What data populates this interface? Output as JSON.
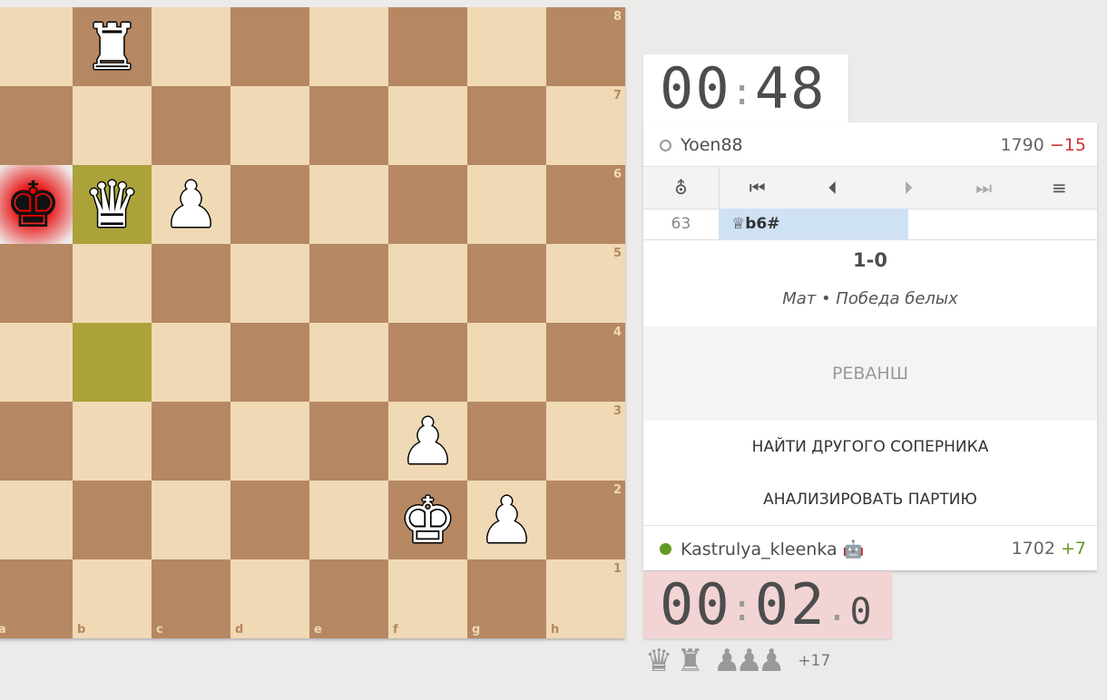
{
  "board": {
    "ranks": [
      "8",
      "7",
      "6",
      "5",
      "4",
      "3",
      "2",
      "1"
    ],
    "files": [
      "a",
      "b",
      "c",
      "d",
      "e",
      "f",
      "g",
      "h"
    ],
    "pieces": [
      {
        "square": "b8",
        "piece": "♜",
        "color": "white",
        "name": "white-rook"
      },
      {
        "square": "a6",
        "piece": "♚",
        "color": "black",
        "name": "black-king"
      },
      {
        "square": "b6",
        "piece": "♛",
        "color": "white",
        "name": "white-queen"
      },
      {
        "square": "c6",
        "piece": "♟",
        "color": "white",
        "name": "white-pawn"
      },
      {
        "square": "f3",
        "piece": "♟",
        "color": "white",
        "name": "white-pawn"
      },
      {
        "square": "f2",
        "piece": "♚",
        "color": "white",
        "name": "white-king"
      },
      {
        "square": "g2",
        "piece": "♟",
        "color": "white",
        "name": "white-pawn"
      }
    ],
    "highlighted": [
      "b6",
      "b4"
    ],
    "check": "a6"
  },
  "top_clock": {
    "minutes": "00",
    "seconds": "48",
    "remaining_fraction": 0.35
  },
  "top_player": {
    "name": "Yoen88",
    "rating": "1790",
    "diff": "−15",
    "online": false
  },
  "controls": {
    "analysis": "⛢",
    "first": "⏮",
    "prev": "⏴",
    "next": "⏵",
    "last": "⏭",
    "menu": "≡"
  },
  "moves": {
    "index": "63",
    "move": "♕b6#"
  },
  "result": {
    "score": "1-0",
    "status": "Мат • Победа белых"
  },
  "actions": {
    "rematch": "РЕВАНШ",
    "new_opponent": "НАЙТИ ДРУГОГО СОПЕРНИКА",
    "analyse": "АНАЛИЗИРОВАТЬ ПАРТИЮ"
  },
  "bottom_player": {
    "name": "Kastrulya_kleenka 🤖",
    "rating": "1702",
    "diff": "+7",
    "online": true
  },
  "bottom_clock": {
    "minutes": "00",
    "seconds": "02",
    "tenths": "0"
  },
  "material": {
    "pieces": [
      "♛",
      "♜",
      "♟",
      "♟",
      "♟"
    ],
    "score": "+17"
  },
  "colors": {
    "light": "#f0d9b5",
    "dark": "#b58863",
    "highlight": "#aba23a",
    "accent": "#629924"
  }
}
